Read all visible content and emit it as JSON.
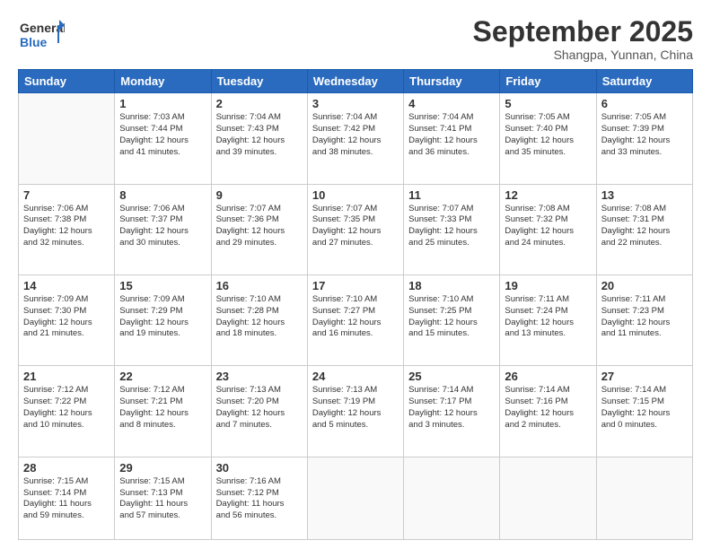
{
  "header": {
    "logo_general": "General",
    "logo_blue": "Blue",
    "month": "September 2025",
    "location": "Shangpa, Yunnan, China"
  },
  "weekdays": [
    "Sunday",
    "Monday",
    "Tuesday",
    "Wednesday",
    "Thursday",
    "Friday",
    "Saturday"
  ],
  "weeks": [
    [
      {
        "day": "",
        "info": ""
      },
      {
        "day": "1",
        "info": "Sunrise: 7:03 AM\nSunset: 7:44 PM\nDaylight: 12 hours\nand 41 minutes."
      },
      {
        "day": "2",
        "info": "Sunrise: 7:04 AM\nSunset: 7:43 PM\nDaylight: 12 hours\nand 39 minutes."
      },
      {
        "day": "3",
        "info": "Sunrise: 7:04 AM\nSunset: 7:42 PM\nDaylight: 12 hours\nand 38 minutes."
      },
      {
        "day": "4",
        "info": "Sunrise: 7:04 AM\nSunset: 7:41 PM\nDaylight: 12 hours\nand 36 minutes."
      },
      {
        "day": "5",
        "info": "Sunrise: 7:05 AM\nSunset: 7:40 PM\nDaylight: 12 hours\nand 35 minutes."
      },
      {
        "day": "6",
        "info": "Sunrise: 7:05 AM\nSunset: 7:39 PM\nDaylight: 12 hours\nand 33 minutes."
      }
    ],
    [
      {
        "day": "7",
        "info": "Sunrise: 7:06 AM\nSunset: 7:38 PM\nDaylight: 12 hours\nand 32 minutes."
      },
      {
        "day": "8",
        "info": "Sunrise: 7:06 AM\nSunset: 7:37 PM\nDaylight: 12 hours\nand 30 minutes."
      },
      {
        "day": "9",
        "info": "Sunrise: 7:07 AM\nSunset: 7:36 PM\nDaylight: 12 hours\nand 29 minutes."
      },
      {
        "day": "10",
        "info": "Sunrise: 7:07 AM\nSunset: 7:35 PM\nDaylight: 12 hours\nand 27 minutes."
      },
      {
        "day": "11",
        "info": "Sunrise: 7:07 AM\nSunset: 7:33 PM\nDaylight: 12 hours\nand 25 minutes."
      },
      {
        "day": "12",
        "info": "Sunrise: 7:08 AM\nSunset: 7:32 PM\nDaylight: 12 hours\nand 24 minutes."
      },
      {
        "day": "13",
        "info": "Sunrise: 7:08 AM\nSunset: 7:31 PM\nDaylight: 12 hours\nand 22 minutes."
      }
    ],
    [
      {
        "day": "14",
        "info": "Sunrise: 7:09 AM\nSunset: 7:30 PM\nDaylight: 12 hours\nand 21 minutes."
      },
      {
        "day": "15",
        "info": "Sunrise: 7:09 AM\nSunset: 7:29 PM\nDaylight: 12 hours\nand 19 minutes."
      },
      {
        "day": "16",
        "info": "Sunrise: 7:10 AM\nSunset: 7:28 PM\nDaylight: 12 hours\nand 18 minutes."
      },
      {
        "day": "17",
        "info": "Sunrise: 7:10 AM\nSunset: 7:27 PM\nDaylight: 12 hours\nand 16 minutes."
      },
      {
        "day": "18",
        "info": "Sunrise: 7:10 AM\nSunset: 7:25 PM\nDaylight: 12 hours\nand 15 minutes."
      },
      {
        "day": "19",
        "info": "Sunrise: 7:11 AM\nSunset: 7:24 PM\nDaylight: 12 hours\nand 13 minutes."
      },
      {
        "day": "20",
        "info": "Sunrise: 7:11 AM\nSunset: 7:23 PM\nDaylight: 12 hours\nand 11 minutes."
      }
    ],
    [
      {
        "day": "21",
        "info": "Sunrise: 7:12 AM\nSunset: 7:22 PM\nDaylight: 12 hours\nand 10 minutes."
      },
      {
        "day": "22",
        "info": "Sunrise: 7:12 AM\nSunset: 7:21 PM\nDaylight: 12 hours\nand 8 minutes."
      },
      {
        "day": "23",
        "info": "Sunrise: 7:13 AM\nSunset: 7:20 PM\nDaylight: 12 hours\nand 7 minutes."
      },
      {
        "day": "24",
        "info": "Sunrise: 7:13 AM\nSunset: 7:19 PM\nDaylight: 12 hours\nand 5 minutes."
      },
      {
        "day": "25",
        "info": "Sunrise: 7:14 AM\nSunset: 7:17 PM\nDaylight: 12 hours\nand 3 minutes."
      },
      {
        "day": "26",
        "info": "Sunrise: 7:14 AM\nSunset: 7:16 PM\nDaylight: 12 hours\nand 2 minutes."
      },
      {
        "day": "27",
        "info": "Sunrise: 7:14 AM\nSunset: 7:15 PM\nDaylight: 12 hours\nand 0 minutes."
      }
    ],
    [
      {
        "day": "28",
        "info": "Sunrise: 7:15 AM\nSunset: 7:14 PM\nDaylight: 11 hours\nand 59 minutes."
      },
      {
        "day": "29",
        "info": "Sunrise: 7:15 AM\nSunset: 7:13 PM\nDaylight: 11 hours\nand 57 minutes."
      },
      {
        "day": "30",
        "info": "Sunrise: 7:16 AM\nSunset: 7:12 PM\nDaylight: 11 hours\nand 56 minutes."
      },
      {
        "day": "",
        "info": ""
      },
      {
        "day": "",
        "info": ""
      },
      {
        "day": "",
        "info": ""
      },
      {
        "day": "",
        "info": ""
      }
    ]
  ]
}
